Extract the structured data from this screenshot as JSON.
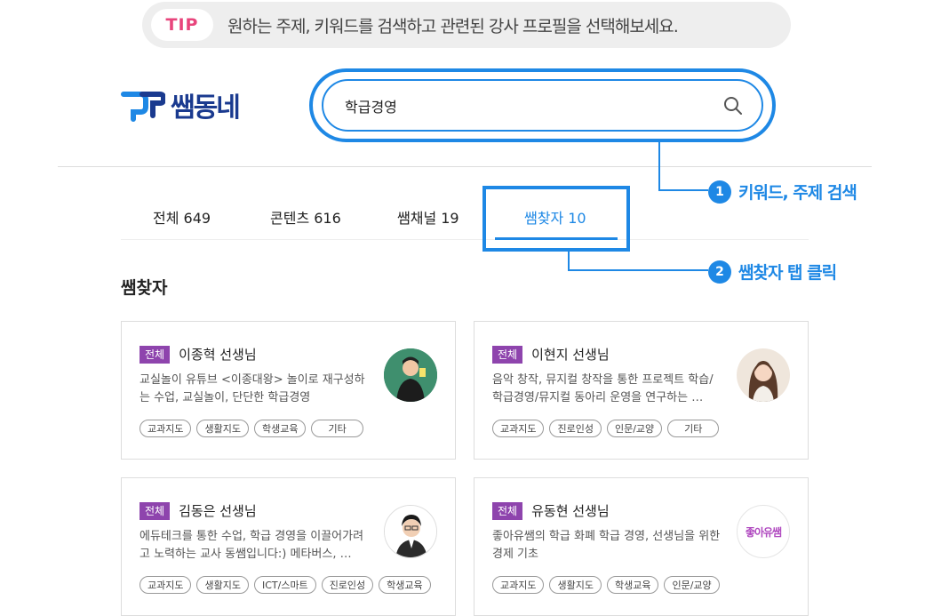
{
  "tip": {
    "badge": "TIP",
    "text": "원하는 주제, 키워드를 검색하고 관련된 강사 프로필을 선택해보세요."
  },
  "logo": {
    "text": "쌤동네"
  },
  "search": {
    "value": "학급경영",
    "icon": "search-icon"
  },
  "callouts": [
    {
      "number": "1",
      "text": "키워드, 주제 검색"
    },
    {
      "number": "2",
      "text": "쌤찾자 탭 클릭"
    }
  ],
  "tabs": [
    {
      "label": "전체 649",
      "active": false
    },
    {
      "label": "콘텐츠 616",
      "active": false
    },
    {
      "label": "쌤채널  19",
      "active": false
    },
    {
      "label": "쌤찾자 10",
      "active": true
    }
  ],
  "section_title": "쌤찾자",
  "cards": [
    {
      "badge": "전체",
      "name": "이종혁 선생님",
      "desc": "교실놀이 유튜브 <이종대왕> 놀이로 재구성하는 수업, 교실놀이, 단단한 학급경영",
      "tags": [
        "교과지도",
        "생활지도",
        "학생교육",
        "기타"
      ],
      "avatar": "teacher-photo"
    },
    {
      "badge": "전체",
      "name": "이현지 선생님",
      "desc": "음악 창작, 뮤지컬 창작을 통한 프로젝트 학습/학급경영/뮤지컬 동아리 운영을 연구하는 …",
      "tags": [
        "교과지도",
        "진로인성",
        "인문/교양",
        "기타"
      ],
      "avatar": "teacher-photo"
    },
    {
      "badge": "전체",
      "name": "김동은 선생님",
      "desc": "에듀테크를 통한 수업, 학급 경영을 이끌어가려고 노력하는 교사 동쌤입니다:) 메타버스, …",
      "tags": [
        "교과지도",
        "생활지도",
        "ICT/스마트",
        "진로인성",
        "학생교육"
      ],
      "avatar": "teacher-photo"
    },
    {
      "badge": "전체",
      "name": "유동현 선생님",
      "desc": "좋아유쌤의 학급 화폐 학급 경영, 선생님을 위한 경제 기초",
      "tags": [
        "교과지도",
        "생활지도",
        "학생교육",
        "인문/교양"
      ],
      "avatar": "logo",
      "avatar_text": "좋아유쌤"
    }
  ],
  "colors": {
    "accent": "#1e88e5",
    "brand": "#1a3a8f",
    "badge": "#8e44ad",
    "tip": "#e8457c"
  }
}
